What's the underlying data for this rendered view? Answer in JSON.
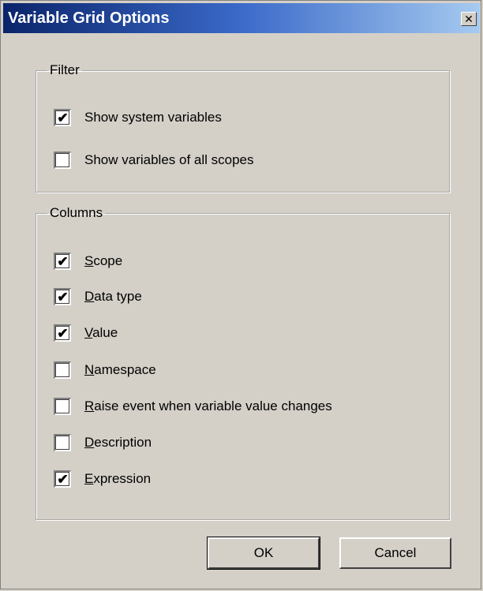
{
  "window": {
    "title": "Variable Grid Options",
    "close_glyph": "✕"
  },
  "filter": {
    "legend": "Filter",
    "items": [
      {
        "label": "Show system variables",
        "checked": true
      },
      {
        "label": "Show variables of all scopes",
        "checked": false
      }
    ]
  },
  "columns": {
    "legend": "Columns",
    "items": [
      {
        "label": "Scope",
        "mnemonic_first": "S",
        "rest": "cope",
        "checked": true
      },
      {
        "label": "Data type",
        "mnemonic_first": "D",
        "rest": "ata type",
        "checked": true
      },
      {
        "label": "Value",
        "mnemonic_first": "V",
        "rest": "alue",
        "checked": true
      },
      {
        "label": "Namespace",
        "mnemonic_first": "N",
        "rest": "amespace",
        "checked": false
      },
      {
        "label": "Raise event when variable value changes",
        "mnemonic_first": "R",
        "rest": "aise event when variable value changes",
        "checked": false
      },
      {
        "label": "Description",
        "mnemonic_first": "D",
        "rest": "escription",
        "checked": false
      },
      {
        "label": "Expression",
        "mnemonic_first": "E",
        "rest": "xpression",
        "checked": true
      }
    ]
  },
  "buttons": {
    "ok": "OK",
    "cancel": "Cancel"
  },
  "check_glyph": "✔"
}
